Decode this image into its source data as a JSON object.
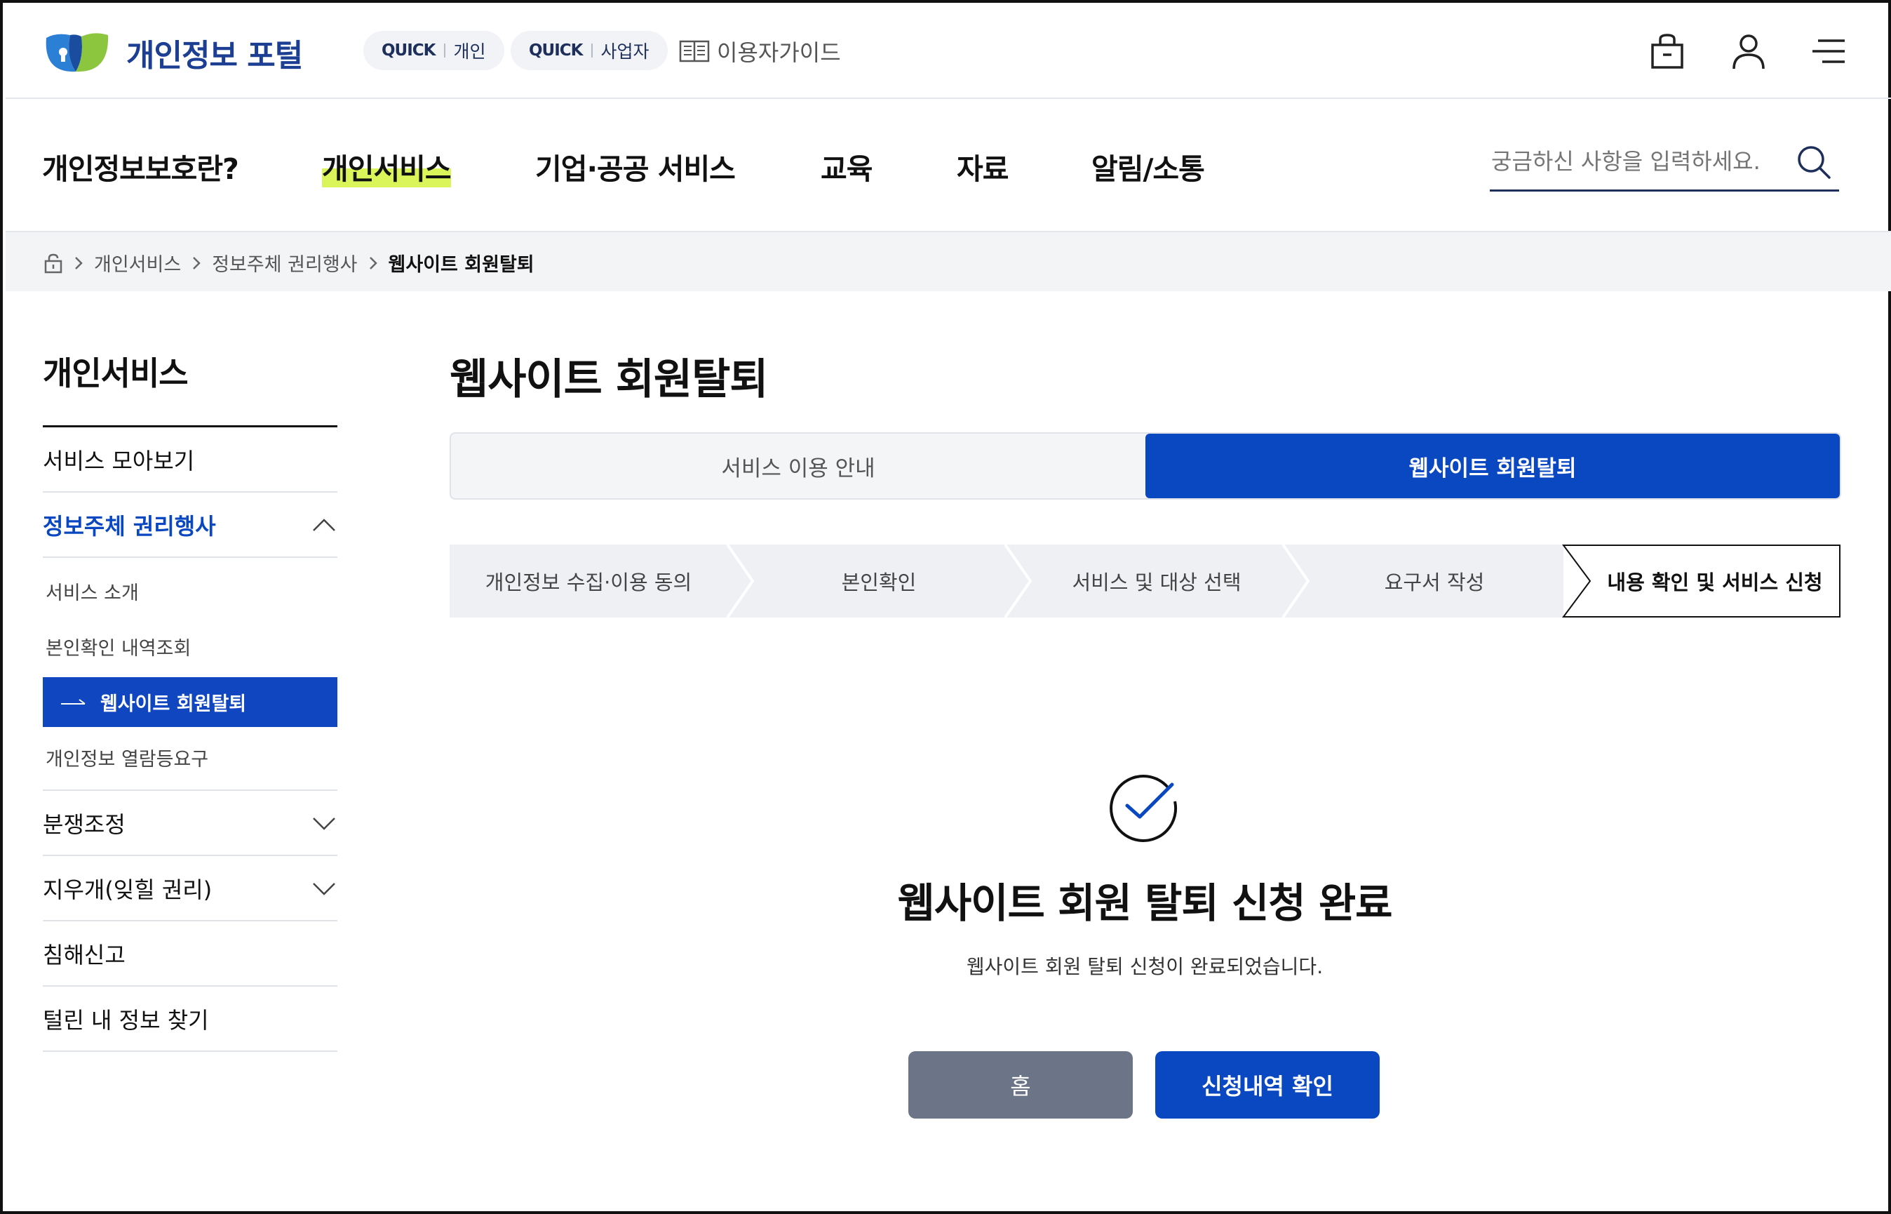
{
  "header": {
    "logo_text": "개인정보 포털",
    "quick_personal": {
      "prefix": "QUICK",
      "label": "개인"
    },
    "quick_business": {
      "prefix": "QUICK",
      "label": "사업자"
    },
    "guide_label": "이용자가이드",
    "icons": [
      "lock-bag-icon",
      "user-icon",
      "menu-icon"
    ]
  },
  "nav": {
    "items": [
      "개인정보보호란?",
      "개인서비스",
      "기업·공공 서비스",
      "교육",
      "자료",
      "알림/소통"
    ],
    "active_index": 1,
    "search_placeholder": "궁금하신 사항을 입력하세요."
  },
  "breadcrumb": {
    "items": [
      "개인서비스",
      "정보주체 권리행사",
      "웹사이트 회원탈퇴"
    ]
  },
  "sidebar": {
    "title": "개인서비스",
    "items": [
      {
        "label": "서비스 모아보기"
      },
      {
        "label": "정보주체 권리행사",
        "expanded": true,
        "children": [
          "서비스 소개",
          "본인확인 내역조회",
          "웹사이트 회원탈퇴",
          "개인정보 열람등요구"
        ],
        "active_child": 2
      },
      {
        "label": "분쟁조정",
        "collapsible": true
      },
      {
        "label": "지우개(잊힐 권리)",
        "collapsible": true
      },
      {
        "label": "침해신고"
      },
      {
        "label": "털린 내 정보 찾기"
      }
    ]
  },
  "content": {
    "title": "웹사이트 회원탈퇴",
    "tabs": [
      "서비스 이용 안내",
      "웹사이트 회원탈퇴"
    ],
    "active_tab": 1,
    "steps": [
      "개인정보 수집·이용 동의",
      "본인확인",
      "서비스 및 대상 선택",
      "요구서 작성",
      "내용 확인 및 서비스 신청"
    ],
    "current_step": 4,
    "complete_title": "웹사이트 회원 탈퇴 신청 완료",
    "complete_desc": "웹사이트 회원 탈퇴 신청이 완료되었습니다.",
    "buttons": {
      "home": "홈",
      "history": "신청내역 확인"
    }
  },
  "colors": {
    "primary": "#0a48c2",
    "brand_navy": "#1d3f93",
    "highlight": "#d9f55a",
    "step_bg": "#eef0f3",
    "home_button": "#6c7588"
  }
}
